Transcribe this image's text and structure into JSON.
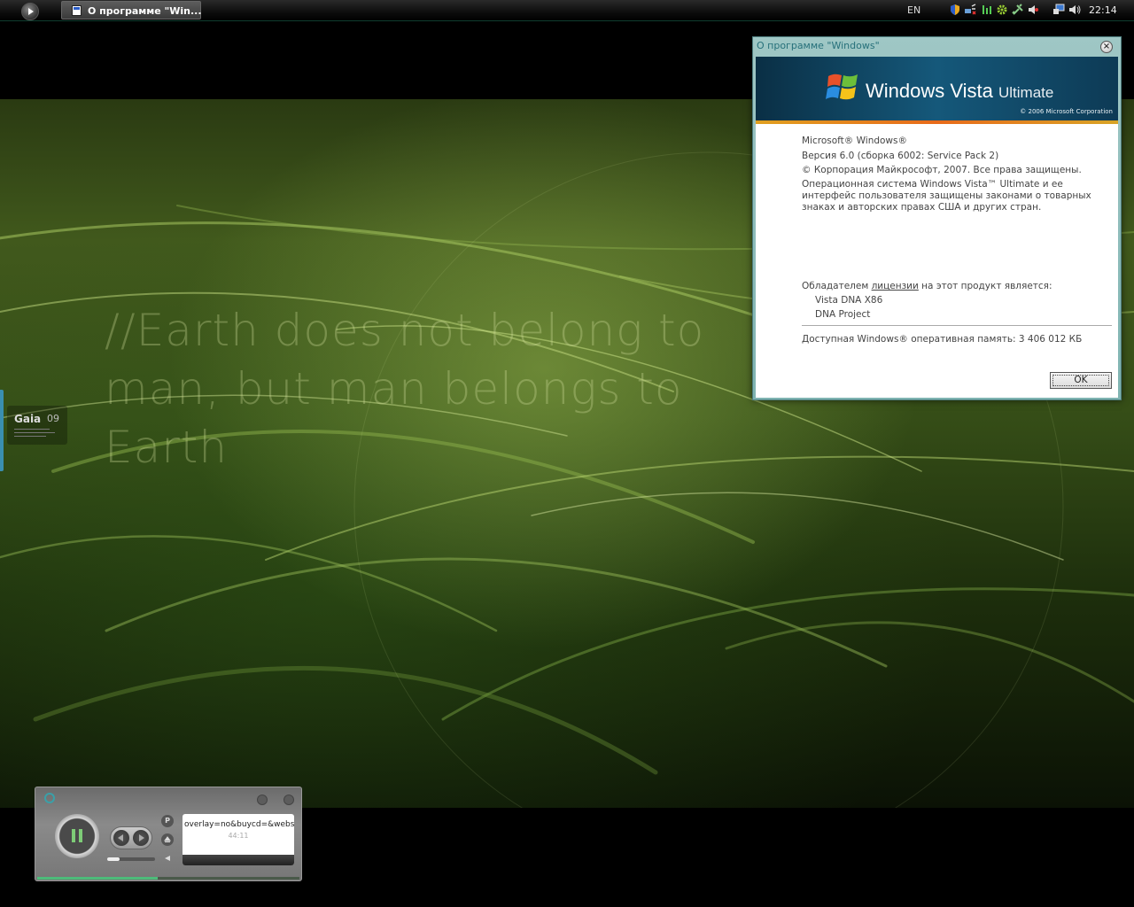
{
  "taskbar": {
    "active_task_label": "О программе \"Win...",
    "language": "EN",
    "clock": "22:14",
    "tray_icons": [
      "shield-icon",
      "network-icon",
      "equalizer-icon",
      "gear-icon",
      "tools-icon",
      "volume-mute-icon",
      "display-icon",
      "volume-icon"
    ]
  },
  "desktop": {
    "quote": "//Earth does not belong to man, but man belongs to Earth",
    "widget": {
      "title": "Gaia",
      "number": "09"
    }
  },
  "about_dialog": {
    "title": "О программе \"Windows\"",
    "brand": "Windows Vista",
    "edition": "Ultimate",
    "copyright_banner": "© 2006 Microsoft Corporation",
    "product": "Microsoft® Windows®",
    "version": "Версия 6.0 (сборка 6002: Service Pack 2)",
    "copyright": "© Корпорация Майкрософт, 2007. Все права защищены.",
    "description": "Операционная система Windows Vista™ Ultimate и ее интерфейс пользователя защищены законами о товарных знаках и авторских правах США и других стран.",
    "owner_prefix": "Обладателем ",
    "owner_link": "лицензии",
    "owner_suffix": " на этот продукт является:",
    "owner_name": "Vista DNA X86",
    "owner_org": "DNA Project",
    "memory": "Доступная Windows® оперативная память: 3 406 012 КБ",
    "ok_label": "OK"
  },
  "player": {
    "p_label": "P",
    "url": "overlay=no&buycd=&webs",
    "time": "44:11",
    "seek_fraction": 0.25,
    "progress_fraction": 0.46,
    "accent": "#4dbb7a"
  }
}
